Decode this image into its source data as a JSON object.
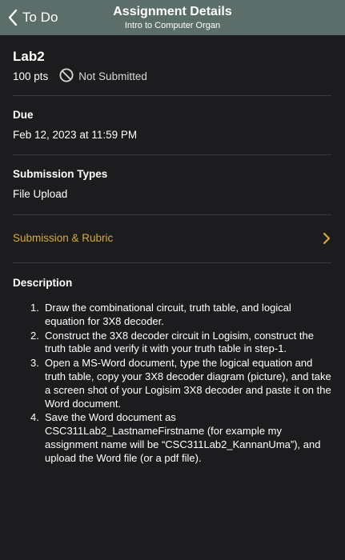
{
  "nav": {
    "back_label": "To Do",
    "title": "Assignment Details",
    "subtitle": "Intro to Computer Organ"
  },
  "assignment": {
    "name": "Lab2",
    "points": "100 pts",
    "status": "Not Submitted"
  },
  "due": {
    "label": "Due",
    "value": "Feb 12, 2023 at 11:59 PM"
  },
  "submission_types": {
    "label": "Submission Types",
    "value": "File Upload"
  },
  "rubric": {
    "label": "Submission & Rubric"
  },
  "description": {
    "label": "Description",
    "items": [
      {
        "num": "1.",
        "text": "Draw the combinational circuit, truth table, and logical equation for 3X8 decoder."
      },
      {
        "num": "2.",
        "text": "Construct the 3X8 decoder circuit in Logisim, construct the truth table and verify it with your truth table in step-1."
      },
      {
        "num": "3.",
        "text": "Open a MS-Word document, type the logical equation and truth table, copy your 3X8 decoder diagram (picture), and take a screen shot of your Logisim 3X8 decoder and paste it on the Word document."
      },
      {
        "num": "4.",
        "text": "Save the Word document as CSC311Lab2_LastnameFirstname (for example my assignment name will be “CSC311Lab2_KannanUma”), and upload the Word file (or a pdf file)."
      }
    ]
  },
  "colors": {
    "nav_bar": "#5b6e6a",
    "background": "#1c1c1e",
    "link_accent": "#d8a93c",
    "divider": "#3a3a3c"
  },
  "icons": {
    "back": "chevron-left-icon",
    "status": "not-submitted-icon",
    "rubric": "chevron-right-icon"
  }
}
